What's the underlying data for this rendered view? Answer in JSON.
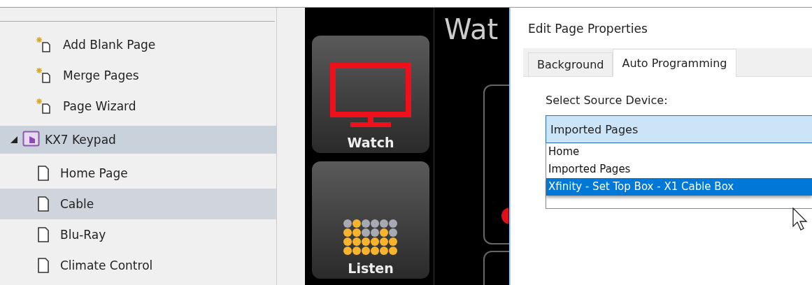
{
  "sidebar": {
    "items": [
      {
        "kind": "action",
        "label": "Add Blank Page",
        "selected": false
      },
      {
        "kind": "action",
        "label": "Merge Pages",
        "selected": false
      },
      {
        "kind": "action",
        "label": "Page Wizard",
        "selected": false
      },
      {
        "kind": "group",
        "label": "KX7 Keypad",
        "selected": false,
        "expanded": true,
        "children": [
          {
            "kind": "page",
            "label": "Home Page",
            "selected": false
          },
          {
            "kind": "page",
            "label": "Cable",
            "selected": true
          },
          {
            "kind": "page",
            "label": "Blu-Ray",
            "selected": false
          },
          {
            "kind": "page",
            "label": "Climate Control",
            "selected": false
          }
        ]
      }
    ]
  },
  "preview": {
    "tiles": [
      {
        "kind": "tv",
        "label": "Watch"
      },
      {
        "kind": "dots",
        "label": "Listen"
      }
    ],
    "heading": "Wat"
  },
  "dialog": {
    "title": "Edit Page Properties",
    "tabs": [
      {
        "label": "Background",
        "selected": false
      },
      {
        "label": "Auto Programming",
        "selected": true
      }
    ],
    "field_label": "Select Source Device:",
    "combo": {
      "value": "Imported Pages",
      "expanded": true,
      "options": [
        {
          "label": "Home",
          "highlighted": false
        },
        {
          "label": "Imported Pages",
          "highlighted": false
        },
        {
          "label": "Xfinity - Set Top Box - X1 Cable Box",
          "highlighted": true
        }
      ]
    }
  }
}
